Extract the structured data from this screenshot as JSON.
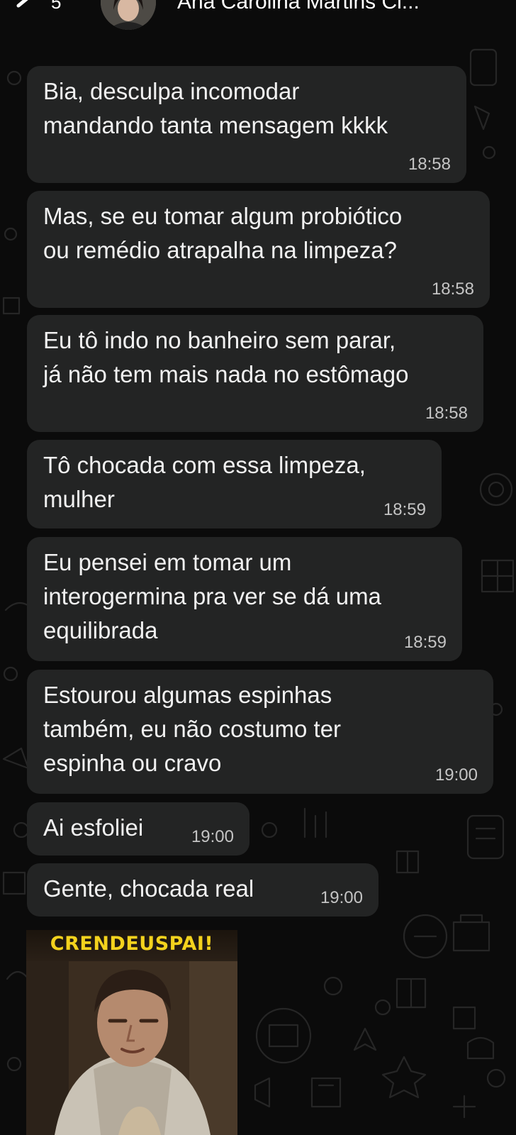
{
  "header": {
    "back_count": "5",
    "contact_name": "Ana Carolina Martins Cl...",
    "back_icon": "chevron-left-icon",
    "avatar": "contact-avatar",
    "call_icon": "video-call-icon"
  },
  "theme": {
    "chat_background": "#0b0b0b",
    "bubble_incoming": "#232424",
    "text_primary": "#f1f1f1",
    "text_timestamp": "#c4c4c4",
    "sticker_caption_color": "#f4d21d"
  },
  "messages": [
    {
      "text": "Bia, desculpa incomodar\nmandando tanta mensagem kkkk",
      "time": "18:58"
    },
    {
      "text": "Mas, se eu tomar algum probiótico\nou remédio atrapalha na limpeza?",
      "time": "18:58"
    },
    {
      "text": "Eu tô indo no banheiro sem parar,\njá não tem mais nada no estômago",
      "time": "18:58"
    },
    {
      "text": "Tô chocada com essa limpeza,\nmulher",
      "time": "18:59"
    },
    {
      "text": "Eu pensei em tomar um\ninterogermina pra ver se dá uma\nequilibrada",
      "time": "18:59"
    },
    {
      "text": "Estourou algumas espinhas\ntambém, eu não costumo ter\nespinha ou cravo",
      "time": "19:00"
    },
    {
      "text": "Ai esfoliei",
      "time": "19:00"
    },
    {
      "text": "Gente, chocada real",
      "time": "19:00"
    }
  ],
  "sticker": {
    "caption": "CRENDEUSPAI!"
  }
}
